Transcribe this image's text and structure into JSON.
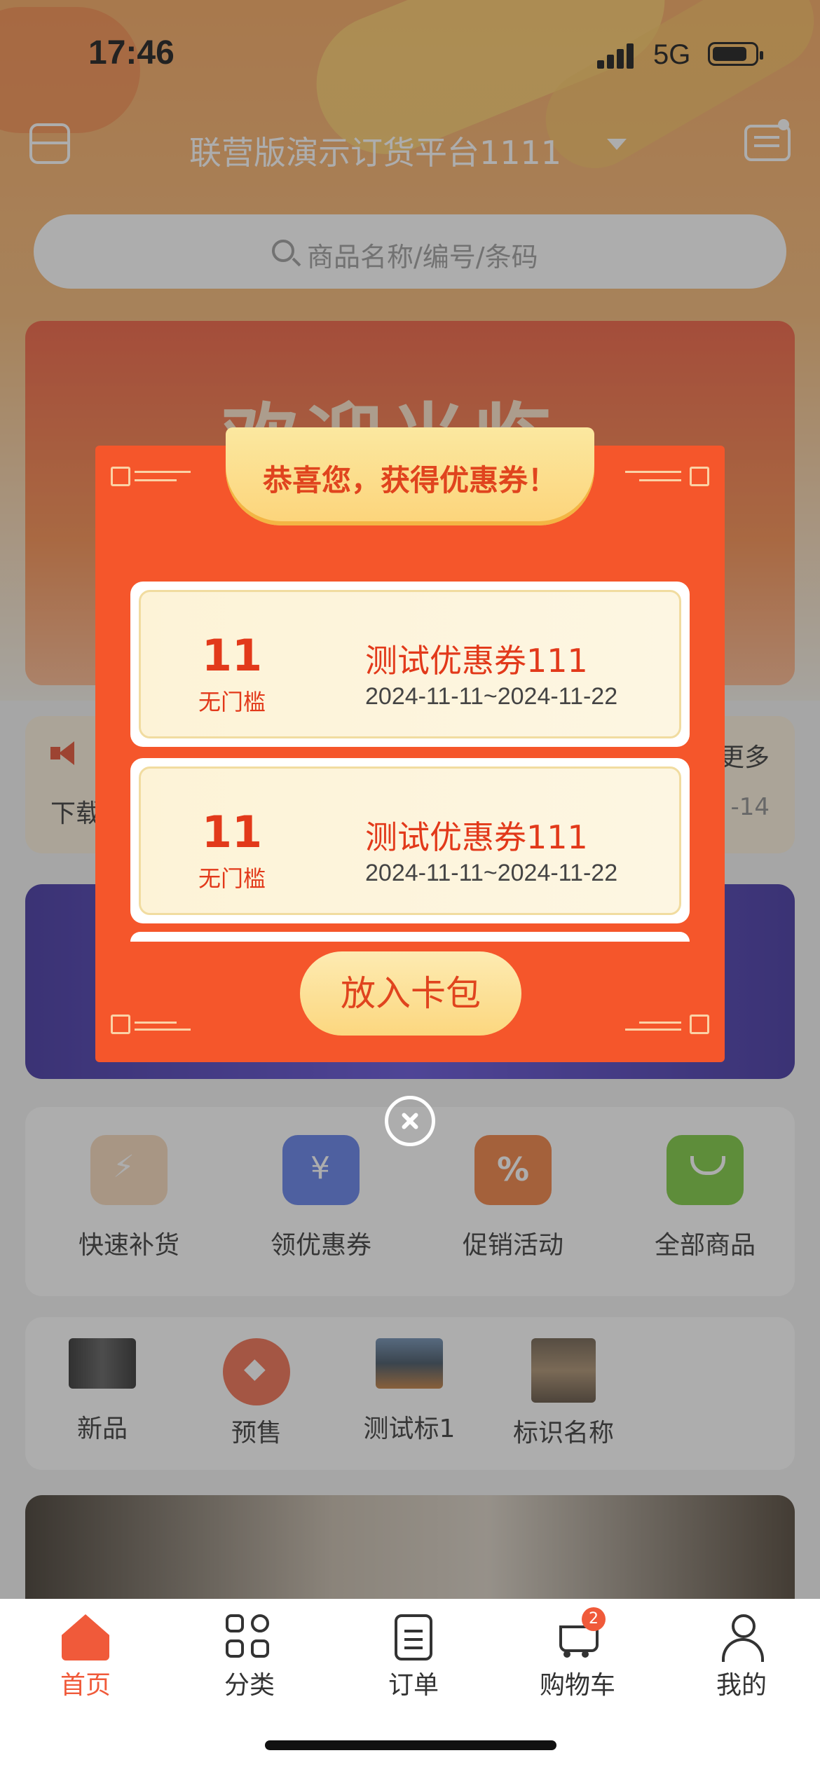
{
  "status_bar": {
    "time": "17:46",
    "network": "5G"
  },
  "header": {
    "store_name": "联营版演示订货平台1111"
  },
  "search": {
    "placeholder": "商品名称/编号/条码"
  },
  "banner": {
    "text": "欢迎光临"
  },
  "notice": {
    "text": "下载",
    "more": "更多",
    "date": "-14"
  },
  "quick_menu": [
    {
      "label": "快速补货",
      "icon": "cart-lightning-icon"
    },
    {
      "label": "领优惠券",
      "icon": "coupon-ticket-icon"
    },
    {
      "label": "促销活动",
      "icon": "gift-percent-icon"
    },
    {
      "label": "全部商品",
      "icon": "shopping-bag-icon"
    }
  ],
  "tag_menu": [
    {
      "label": "新品"
    },
    {
      "label": "预售"
    },
    {
      "label": "测试标1"
    },
    {
      "label": "标识名称"
    }
  ],
  "modal": {
    "title": "恭喜您，获得优惠券！",
    "coupons": [
      {
        "amount": "11",
        "condition": "无门槛",
        "name": "测试优惠券111",
        "date_range": "2024-11-11~2024-11-22"
      },
      {
        "amount": "11",
        "condition": "无门槛",
        "name": "测试优惠券111",
        "date_range": "2024-11-11~2024-11-22"
      }
    ],
    "button_label": "放入卡包"
  },
  "tabbar": {
    "items": [
      {
        "label": "首页",
        "icon": "home-icon",
        "active": true
      },
      {
        "label": "分类",
        "icon": "category-icon",
        "active": false
      },
      {
        "label": "订单",
        "icon": "order-clipboard-icon",
        "active": false
      },
      {
        "label": "购物车",
        "icon": "cart-icon",
        "active": false
      },
      {
        "label": "我的",
        "icon": "profile-icon",
        "active": false
      }
    ],
    "cart_badge": "2"
  },
  "colors": {
    "accent": "#f05a3a",
    "modal_bg": "#f5562b",
    "coupon_text": "#e2391a",
    "gold": "#fcd77f"
  }
}
